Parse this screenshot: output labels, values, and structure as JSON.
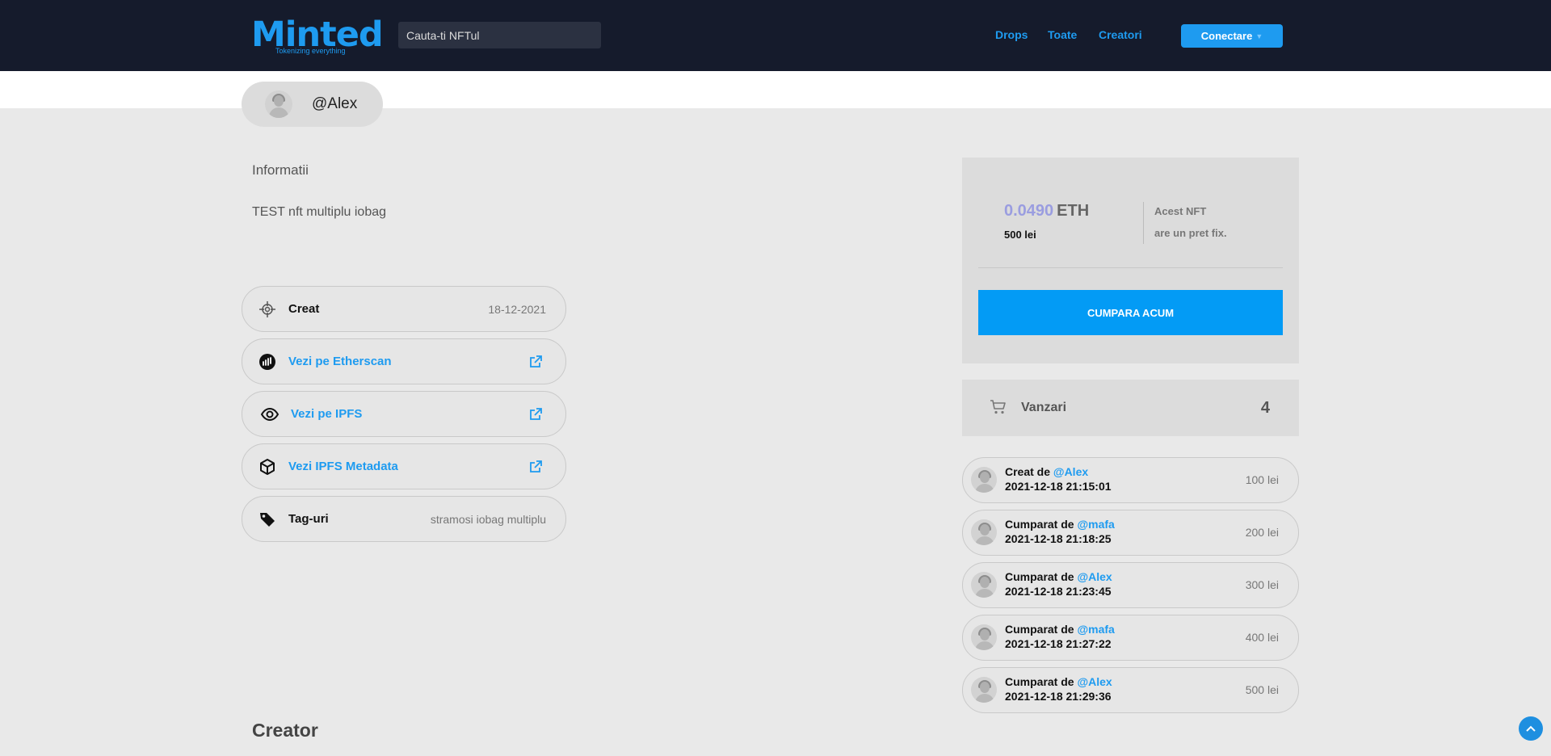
{
  "header": {
    "logo_text": "Minted",
    "logo_tagline": "Tokenizing everything",
    "search_placeholder": "Cauta-ti NFTul",
    "nav": [
      "Drops",
      "Toate",
      "Creatori"
    ],
    "connect_label": "Conectare"
  },
  "owner": {
    "username": "@Alex"
  },
  "info": {
    "title": "Informatii",
    "description": "TEST nft multiplu iobag"
  },
  "details": {
    "created_label": "Creat",
    "created_date": "18-12-2021",
    "etherscan_label": "Vezi pe Etherscan",
    "ipfs_label": "Vezi pe IPFS",
    "ipfs_metadata_label": "Vezi IPFS Metadata",
    "tags_label": "Tag-uri",
    "tags_value": "stramosi iobag multiplu"
  },
  "purchase": {
    "price_eth": "0.0490",
    "price_unit": "ETH",
    "price_lei": "500 lei",
    "fixed_line1": "Acest NFT",
    "fixed_line2": "are un pret fix.",
    "buy_label": "CUMPARA ACUM"
  },
  "sales": {
    "label": "Vanzari",
    "count": "4"
  },
  "history": [
    {
      "action": "Creat de",
      "user": "@Alex",
      "datetime": "2021-12-18 21:15:01",
      "price": "100 lei"
    },
    {
      "action": "Cumparat de",
      "user": "@mafa",
      "datetime": "2021-12-18 21:18:25",
      "price": "200 lei"
    },
    {
      "action": "Cumparat de",
      "user": "@Alex",
      "datetime": "2021-12-18 21:23:45",
      "price": "300 lei"
    },
    {
      "action": "Cumparat de",
      "user": "@mafa",
      "datetime": "2021-12-18 21:27:22",
      "price": "400 lei"
    },
    {
      "action": "Cumparat de",
      "user": "@Alex",
      "datetime": "2021-12-18 21:29:36",
      "price": "500 lei"
    }
  ],
  "creator_title": "Creator",
  "colors": {
    "accent": "#1e9bf0",
    "header_bg": "#151b2c",
    "page_bg": "#e9e9e9",
    "eth_price": "#9a9de0"
  }
}
